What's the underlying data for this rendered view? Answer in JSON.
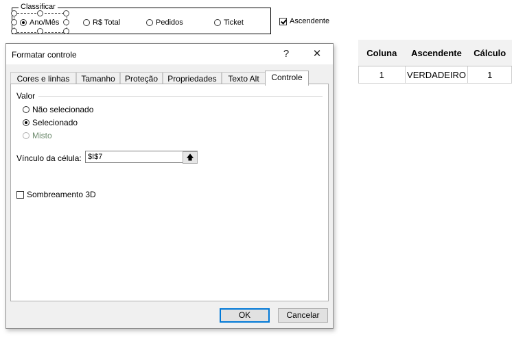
{
  "sheet_controls": {
    "group_title": "Classificar",
    "options": [
      {
        "label": "Ano/Mês",
        "selected": true
      },
      {
        "label": "R$ Total",
        "selected": false
      },
      {
        "label": "Pedidos",
        "selected": false
      },
      {
        "label": "Ticket",
        "selected": false
      }
    ],
    "checkbox": {
      "label": "Ascendente",
      "checked": true
    }
  },
  "sheet_table": {
    "headers": [
      "Coluna",
      "Ascendente",
      "Cálculo"
    ],
    "row": [
      "1",
      "VERDADEIRO",
      "1"
    ]
  },
  "dialog": {
    "title": "Formatar controle",
    "help_label": "?",
    "close_label": "✕",
    "tabs": [
      "Cores e linhas",
      "Tamanho",
      "Proteção",
      "Propriedades",
      "Texto Alt",
      "Controle"
    ],
    "active_tab": "Controle",
    "value_section": "Valor",
    "value_options": [
      {
        "label": "Não selecionado",
        "selected": false,
        "enabled": true
      },
      {
        "label": "Selecionado",
        "selected": true,
        "enabled": true
      },
      {
        "label": "Misto",
        "selected": false,
        "enabled": false
      }
    ],
    "cell_link_label": "Vínculo da célula:",
    "cell_link_value": "$I$7",
    "shading_label": "Sombreamento 3D",
    "shading_checked": false,
    "ok_label": "OK",
    "cancel_label": "Cancelar"
  }
}
